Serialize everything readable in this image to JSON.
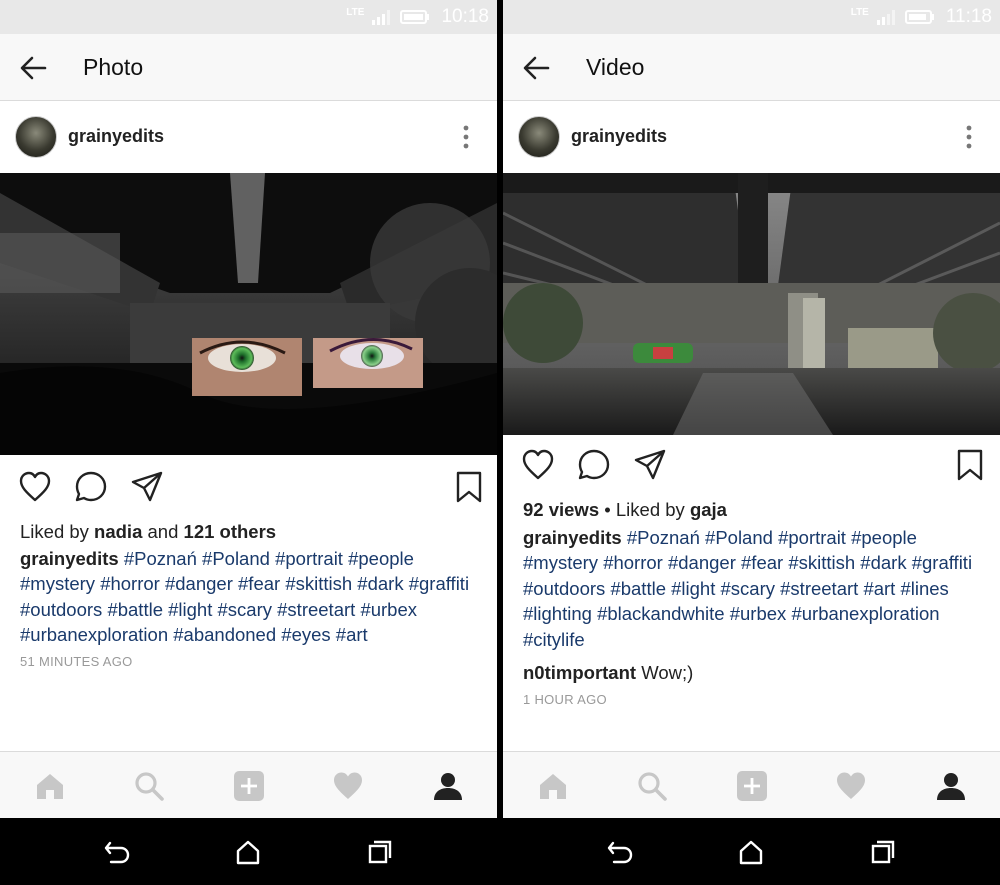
{
  "left": {
    "status": {
      "network": "LTE",
      "time": "10:18"
    },
    "header": {
      "title": "Photo"
    },
    "post": {
      "username": "grainyedits",
      "likes": {
        "prefix": "Liked by ",
        "user": "nadia",
        "middle": " and ",
        "others": "121 others"
      },
      "caption": {
        "username": "grainyedits",
        "hashtags": [
          "#Poznań",
          "#Poland",
          "#portrait",
          "#people",
          "#mystery",
          "#horror",
          "#danger",
          "#fear",
          "#skittish",
          "#dark",
          "#graffiti",
          "#outdoors",
          "#battle",
          "#light",
          "#scary",
          "#streetart",
          "#urbex",
          "#urbanexploration",
          "#abandoned",
          "#eyes",
          "#art"
        ]
      },
      "time": "51 MINUTES AGO"
    }
  },
  "right": {
    "status": {
      "network": "LTE",
      "time": "11:18"
    },
    "header": {
      "title": "Video"
    },
    "post": {
      "username": "grainyedits",
      "views": {
        "count": "92 views",
        "sep": " • Liked by ",
        "user": "gaja"
      },
      "caption": {
        "username": "grainyedits",
        "hashtags": [
          "#Poznań",
          "#Poland",
          "#portrait",
          "#people",
          "#mystery",
          "#horror",
          "#danger",
          "#fear",
          "#skittish",
          "#dark",
          "#graffiti",
          "#outdoors",
          "#battle",
          "#light",
          "#scary",
          "#streetart",
          "#art",
          "#lines",
          "#lighting",
          "#blackandwhite",
          "#urbex",
          "#urbanexploration",
          "#citylife"
        ]
      },
      "comment": {
        "user": "n0timportant",
        "text": "Wow;)"
      },
      "time": "1 HOUR AGO"
    }
  },
  "colors": {
    "hashtag": "#1a3a6b",
    "chrome": "#f8f8f8",
    "status_bar": "#e8e8e8",
    "inactive_icon": "#c7c7c7"
  },
  "icons": {
    "actions": [
      "heart-outline-icon",
      "comment-icon",
      "share-icon",
      "bookmark-icon"
    ],
    "nav": [
      "home-icon",
      "search-icon",
      "add-icon",
      "heart-icon",
      "profile-icon"
    ],
    "system": [
      "back-arrow-icon",
      "home-outline-icon",
      "recents-icon"
    ]
  }
}
